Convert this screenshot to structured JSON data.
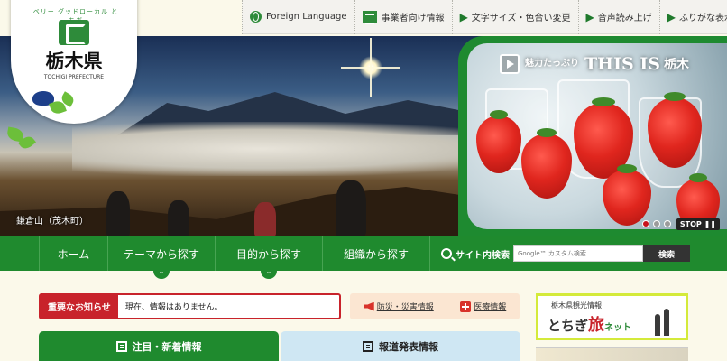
{
  "header": {
    "pref_name": "栃木県",
    "pref_name_en": "TOCHIGI PREFECTURE",
    "tagline": "ベリー グッドローカル とちぎ"
  },
  "topbar": {
    "foreign_language": "Foreign Language",
    "business_info": "事業者向け情報",
    "text_size_color": "文字サイズ・色合い変更",
    "read_aloud": "音声読み上げ",
    "furigana": "ふりがな表示"
  },
  "hero": {
    "caption": "鎌倉山（茂木町）",
    "feature_small": "魅力たっぷり",
    "feature_big": "THIS IS",
    "feature_pref": "栃木",
    "stop_label": "STOP",
    "slide_count": 3,
    "active_slide": 1
  },
  "nav": {
    "items": [
      {
        "label": "ホーム",
        "has_dropdown": false
      },
      {
        "label": "テーマから探す",
        "has_dropdown": true
      },
      {
        "label": "目的から探す",
        "has_dropdown": true
      },
      {
        "label": "組織から探す",
        "has_dropdown": false
      }
    ],
    "search_label": "サイト内検索",
    "search_placeholder": "Google™ カスタム検索",
    "search_button": "検索"
  },
  "notice": {
    "label": "重要なお知らせ",
    "text": "現在、情報はありません。"
  },
  "info_links": {
    "disaster": "防災・災害情報",
    "medical": "医療情報"
  },
  "tabs": [
    {
      "label": "注目・新着情報",
      "active": true
    },
    {
      "label": "報道発表情報",
      "active": false
    }
  ],
  "banner": {
    "sub": "栃木県観光情報",
    "main_prefix": "とちぎ",
    "main_tabi": "旅",
    "main_suffix": "ネット"
  },
  "colors": {
    "brand_green": "#1f8a2e",
    "notice_red": "#c8232b",
    "tab_inactive": "#cfe7f3"
  }
}
